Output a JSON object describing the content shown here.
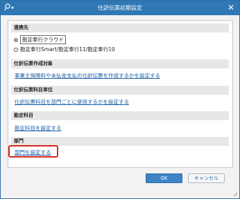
{
  "window": {
    "title": "仕訳伝票初期設定"
  },
  "sections": {
    "link_dest": {
      "header": "連携先",
      "options": [
        "勘定奉行クラウド",
        "勘定奉行Smart/勘定奉行11/勘定奉行10"
      ],
      "selected": "勘定奉行クラウド"
    },
    "target": {
      "header": "仕訳伝票作成対象",
      "link": "事業主保険料や未払金支払の仕訳伝票を作成するかを設定する"
    },
    "subject_unit": {
      "header": "仕訳伝票科目単位",
      "link": "仕訳伝票科目を部門ごとに使用するかを設定する"
    },
    "account": {
      "header": "勘定科目",
      "link": "勘定科目を設定する"
    },
    "department": {
      "header": "部門",
      "link": "部門を設定する"
    }
  },
  "buttons": {
    "ok": "OK",
    "cancel": "キャンセル"
  },
  "colors": {
    "titlebar": "#2f78b5",
    "link": "#1a5ea8",
    "highlight": "#d9261c"
  }
}
